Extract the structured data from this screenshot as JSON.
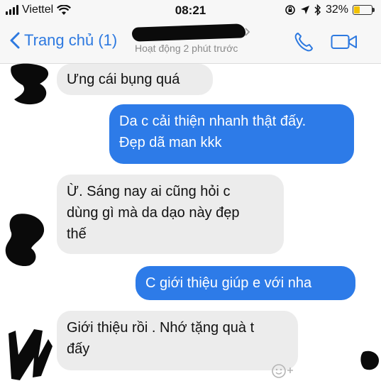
{
  "status_bar": {
    "carrier": "Viettel",
    "time": "08:21",
    "battery": "32%",
    "battery_level": 0.32
  },
  "header": {
    "back_label": "Trang chủ (1)",
    "activity": "Hoạt động 2 phút trước",
    "icons": [
      "back-chevron-icon",
      "phone-icon",
      "video-camera-icon"
    ]
  },
  "messages": [
    {
      "side": "in",
      "text": "Ưng cái bụng quá"
    },
    {
      "side": "out",
      "lines": [
        "Da c cải thiện nhanh thật đấy.",
        "Đẹp dã man kkk"
      ]
    },
    {
      "side": "in",
      "lines": [
        "Ừ. Sáng nay ai cũng hỏi c",
        "dùng gì mà da dạo này đẹp",
        "thế"
      ]
    },
    {
      "side": "out",
      "text": "C giới thiệu giúp e với nha"
    },
    {
      "side": "in",
      "lines": [
        "Giới thiệu rồi . Nhớ tặng quà t",
        "đấy"
      ]
    }
  ],
  "colors": {
    "accent": "#2d79e0",
    "outgoing_bubble": "#2d7be8",
    "incoming_bubble": "#ececec"
  }
}
